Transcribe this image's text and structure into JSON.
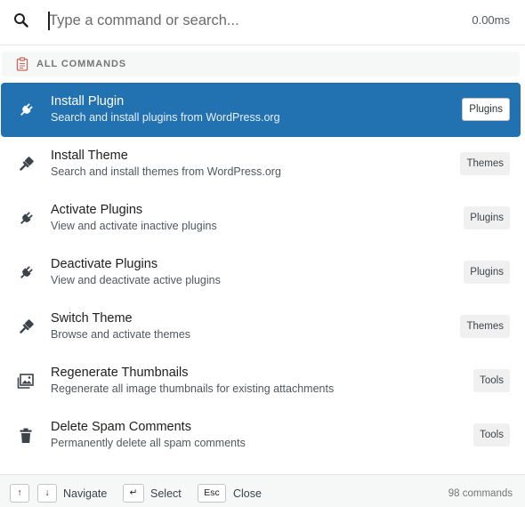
{
  "search": {
    "placeholder": "Type a command or search...",
    "value": "",
    "timing": "0.00ms"
  },
  "group": {
    "label": "ALL COMMANDS",
    "icon": "clipboard-icon"
  },
  "commands": [
    {
      "title": "Install Plugin",
      "description": "Search and install plugins from WordPress.org",
      "tag": "Plugins",
      "icon": "plugin-icon",
      "selected": true
    },
    {
      "title": "Install Theme",
      "description": "Search and install themes from WordPress.org",
      "tag": "Themes",
      "icon": "brush-icon",
      "selected": false
    },
    {
      "title": "Activate Plugins",
      "description": "View and activate inactive plugins",
      "tag": "Plugins",
      "icon": "plugin-icon",
      "selected": false
    },
    {
      "title": "Deactivate Plugins",
      "description": "View and deactivate active plugins",
      "tag": "Plugins",
      "icon": "plugin-icon",
      "selected": false
    },
    {
      "title": "Switch Theme",
      "description": "Browse and activate themes",
      "tag": "Themes",
      "icon": "brush-icon",
      "selected": false
    },
    {
      "title": "Regenerate Thumbnails",
      "description": "Regenerate all image thumbnails for existing attachments",
      "tag": "Tools",
      "icon": "images-icon",
      "selected": false
    },
    {
      "title": "Delete Spam Comments",
      "description": "Permanently delete all spam comments",
      "tag": "Tools",
      "icon": "trash-icon",
      "selected": false
    }
  ],
  "footer": {
    "up_key": "↑",
    "down_key": "↓",
    "navigate_label": "Navigate",
    "enter_key": "↵",
    "select_label": "Select",
    "esc_key": "Esc",
    "close_label": "Close",
    "count": "98 commands"
  },
  "colors": {
    "accent": "#2271b1",
    "tag_bg": "#f0f0f1"
  }
}
